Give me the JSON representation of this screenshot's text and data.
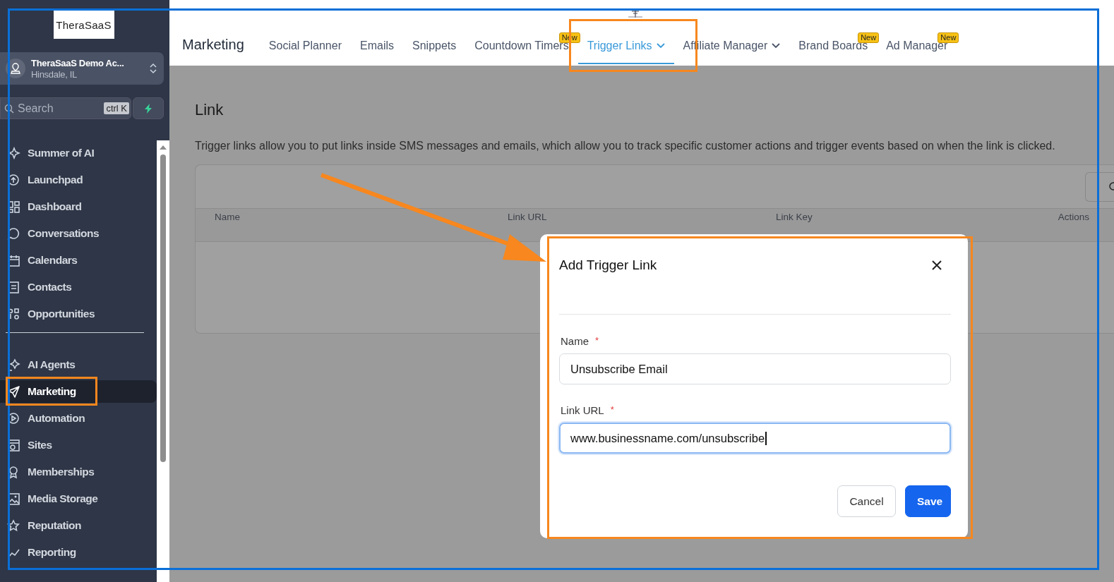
{
  "sidebar": {
    "logo": "TheraSaaS",
    "account": {
      "name": "TheraSaaS Demo Ac...",
      "location": "Hinsdale, IL"
    },
    "search": {
      "placeholder": "Search",
      "shortcut": "ctrl K"
    },
    "groups": [
      {
        "items": [
          {
            "label": "Summer of AI",
            "selected": false
          },
          {
            "label": "Launchpad",
            "selected": false
          },
          {
            "label": "Dashboard",
            "selected": false
          },
          {
            "label": "Conversations",
            "selected": false
          },
          {
            "label": "Calendars",
            "selected": false
          },
          {
            "label": "Contacts",
            "selected": false
          },
          {
            "label": "Opportunities",
            "selected": false
          }
        ]
      },
      {
        "items": [
          {
            "label": "AI Agents",
            "selected": false
          },
          {
            "label": "Marketing",
            "selected": true
          },
          {
            "label": "Automation",
            "selected": false
          },
          {
            "label": "Sites",
            "selected": false
          },
          {
            "label": "Memberships",
            "selected": false
          },
          {
            "label": "Media Storage",
            "selected": false
          },
          {
            "label": "Reputation",
            "selected": false
          },
          {
            "label": "Reporting",
            "selected": false
          }
        ]
      }
    ]
  },
  "header": {
    "title": "Marketing",
    "tabs": [
      {
        "label": "Social Planner",
        "selected": false,
        "dropdown": false
      },
      {
        "label": "Emails",
        "selected": false,
        "dropdown": false
      },
      {
        "label": "Snippets",
        "selected": false,
        "dropdown": false
      },
      {
        "label": "Countdown Timers",
        "selected": false,
        "dropdown": false,
        "badge": "New"
      },
      {
        "label": "Trigger Links",
        "selected": true,
        "dropdown": true
      },
      {
        "label": "Affiliate Manager",
        "selected": false,
        "dropdown": true
      },
      {
        "label": "Brand Boards",
        "selected": false,
        "dropdown": false,
        "badge": "New"
      },
      {
        "label": "Ad Manager",
        "selected": false,
        "dropdown": false,
        "badge": "New"
      }
    ]
  },
  "page": {
    "title": "Link",
    "description": "Trigger links allow you to put links inside SMS messages and emails, which allow you to track specific customer actions and trigger events based on when the link is clicked.",
    "table": {
      "columns": [
        "Name",
        "Link URL",
        "Link Key",
        "Actions"
      ]
    }
  },
  "dialog": {
    "title": "Add Trigger Link",
    "fields": [
      {
        "label": "Name",
        "required_mark": "*",
        "value": "Unsubscribe Email",
        "focused": false
      },
      {
        "label": "Link URL",
        "required_mark": "*",
        "value": "www.businessname.com/unsubscribe",
        "focused": true
      }
    ],
    "buttons": [
      {
        "label": "Cancel",
        "kind": "secondary"
      },
      {
        "label": "Save",
        "kind": "primary"
      }
    ]
  }
}
